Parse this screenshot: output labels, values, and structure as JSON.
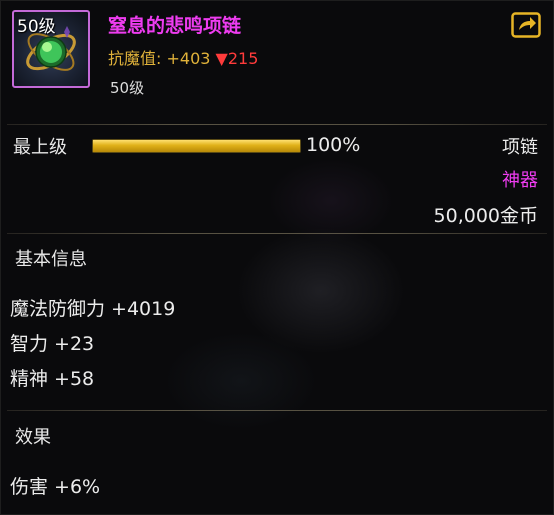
{
  "item": {
    "icon": "green-orb-necklace-icon",
    "level_badge": "50级",
    "name": "窒息的悲鸣项链",
    "resistance_label": "抗魔值:",
    "resistance_value": "+403",
    "resistance_diff_marker": "▼",
    "resistance_diff_value": "215",
    "level_text": "50级"
  },
  "header": {
    "export_icon": "export-arrow-icon"
  },
  "upgrade": {
    "label": "最上级",
    "progress": 1.0,
    "percent_text": "100%"
  },
  "meta": {
    "type": "项链",
    "rarity": "神器",
    "price": "50,000金币"
  },
  "basic_info": {
    "title": "基本信息",
    "stats": [
      "魔法防御力 +4019",
      "智力 +23",
      "精神 +58"
    ]
  },
  "effects": {
    "title": "效果",
    "stats": [
      "伤害 +6%"
    ]
  },
  "colors": {
    "item_name": "#ee3cf0",
    "rarity": "#ee3cf0",
    "resistance": "#e0b23a",
    "decrease": "#ff3b3b",
    "progress_bar": "#e0b018",
    "icon_frame": "#c36ad8"
  }
}
